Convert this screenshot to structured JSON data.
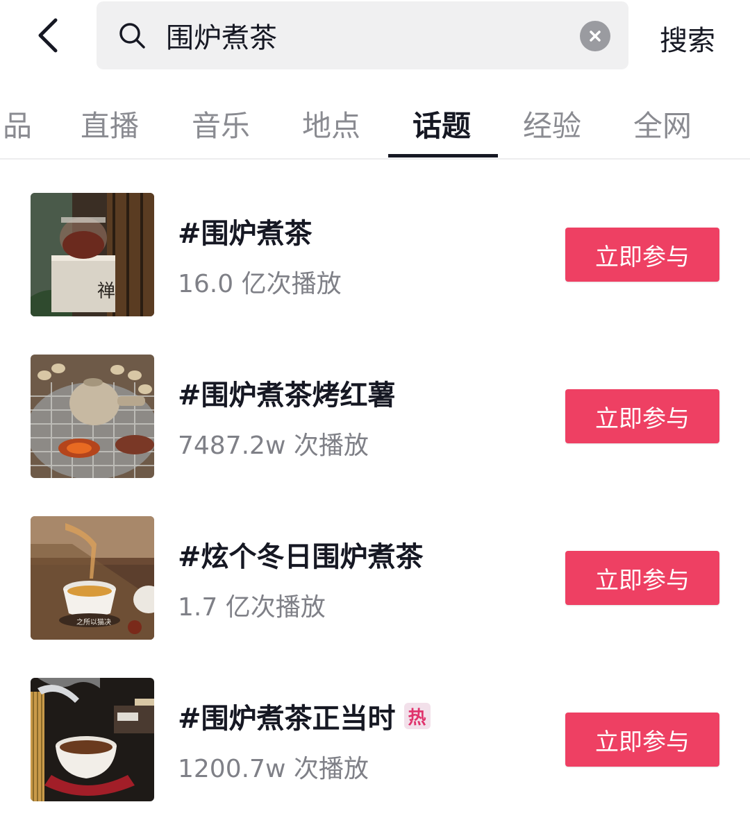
{
  "header": {
    "back_icon": "chevron-left-icon",
    "search": {
      "icon": "search-icon",
      "value": "围炉煮茶",
      "placeholder": ""
    },
    "clear_icon": "close-circle-icon",
    "search_label": "搜索"
  },
  "tabs": [
    {
      "label": "品",
      "active": false
    },
    {
      "label": "直播",
      "active": false
    },
    {
      "label": "音乐",
      "active": false
    },
    {
      "label": "地点",
      "active": false
    },
    {
      "label": "话题",
      "active": true
    },
    {
      "label": "经验",
      "active": false
    },
    {
      "label": "全网",
      "active": false
    }
  ],
  "topics": [
    {
      "title": "#围炉煮茶",
      "plays": "16.0 亿次播放",
      "hot": false,
      "button": "立即参与"
    },
    {
      "title": "#围炉煮茶烤红薯",
      "plays": "7487.2w 次播放",
      "hot": false,
      "button": "立即参与"
    },
    {
      "title": "#炫个冬日围炉煮茶",
      "plays": "1.7 亿次播放",
      "hot": false,
      "button": "立即参与"
    },
    {
      "title": "#围炉煮茶正当时",
      "plays": "1200.7w 次播放",
      "hot": true,
      "hot_label": "热",
      "button": "立即参与"
    }
  ],
  "thumb_3_caption": "之所以猫决",
  "colors": {
    "accent": "#ee4063",
    "text_primary": "#161823",
    "text_secondary": "#7f8087",
    "hot_badge": "#e0336c"
  }
}
